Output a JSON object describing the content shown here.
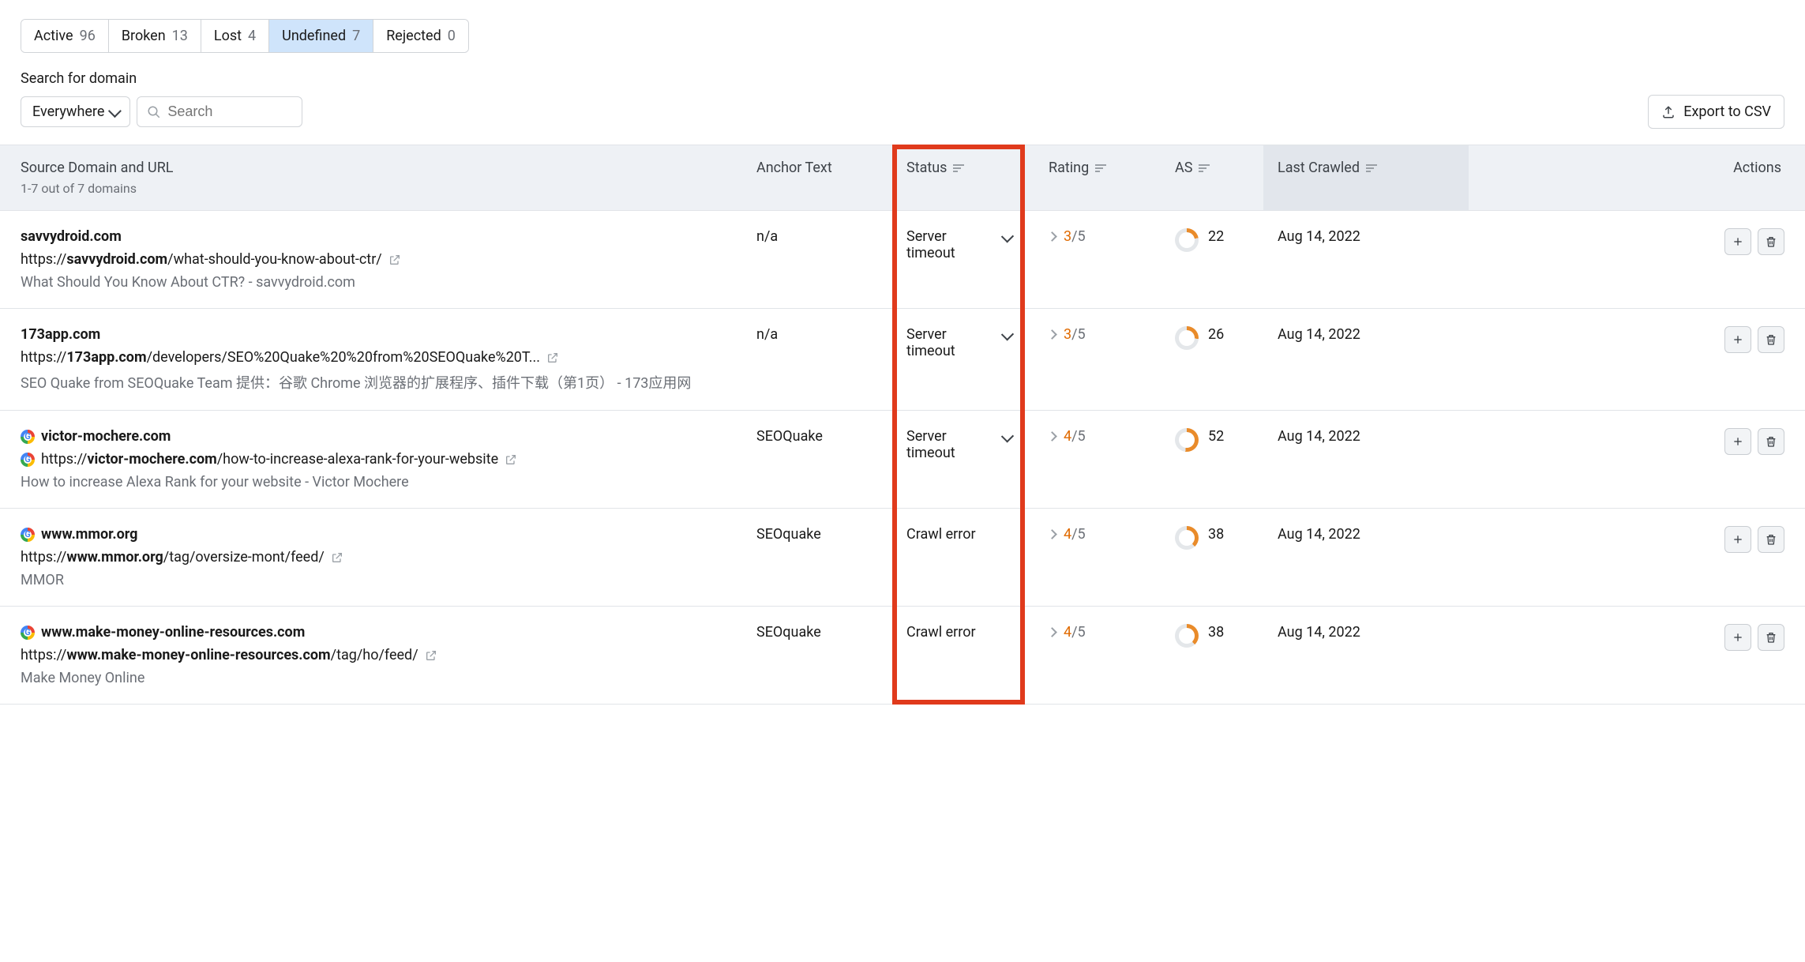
{
  "tabs": [
    {
      "label": "Active",
      "count": "96",
      "active": false
    },
    {
      "label": "Broken",
      "count": "13",
      "active": false
    },
    {
      "label": "Lost",
      "count": "4",
      "active": false
    },
    {
      "label": "Undefined",
      "count": "7",
      "active": true
    },
    {
      "label": "Rejected",
      "count": "0",
      "active": false
    }
  ],
  "search": {
    "label": "Search for domain",
    "scope": "Everywhere",
    "placeholder": "Search"
  },
  "export_label": "Export to CSV",
  "columns": {
    "source": "Source Domain and URL",
    "source_sub": "1-7 out of 7 domains",
    "anchor": "Anchor Text",
    "status": "Status",
    "rating": "Rating",
    "as": "AS",
    "last_crawled": "Last Crawled",
    "actions": "Actions"
  },
  "rows": [
    {
      "favicon": null,
      "domain": "savvydroid.com",
      "url_pre": "https://",
      "url_bold": "savvydroid.com",
      "url_path": "/what-should-you-know-about-ctr/",
      "title": "What Should You Know About CTR? - savvydroid.com",
      "anchor": "n/a",
      "status": "Server timeout",
      "status_dropdown": true,
      "rating_cur": "3",
      "rating_tot": "/5",
      "as": "22",
      "as_pct": 22,
      "crawled": "Aug 14, 2022"
    },
    {
      "favicon": null,
      "domain": "173app.com",
      "url_pre": "https://",
      "url_bold": "173app.com",
      "url_path": "/developers/SEO%20Quake%20%20from%20SEOQuake%20T...",
      "title": "SEO Quake from SEOQuake Team 提供：谷歌 Chrome 浏览器的扩展程序、插件下载（第1页） - 173应用网",
      "anchor": "n/a",
      "status": "Server timeout",
      "status_dropdown": true,
      "rating_cur": "3",
      "rating_tot": "/5",
      "as": "26",
      "as_pct": 26,
      "crawled": "Aug 14, 2022"
    },
    {
      "favicon": "google",
      "domain": "victor-mochere.com",
      "url_pre": "https://",
      "url_bold": "victor-mochere.com",
      "url_path": "/how-to-increase-alexa-rank-for-your-website",
      "url_favicon": "google",
      "title": "How to increase Alexa Rank for your website - Victor Mochere",
      "anchor": "SEOQuake",
      "status": "Server timeout",
      "status_dropdown": true,
      "rating_cur": "4",
      "rating_tot": "/5",
      "as": "52",
      "as_pct": 52,
      "crawled": "Aug 14, 2022"
    },
    {
      "favicon": "google",
      "domain": "www.mmor.org",
      "url_pre": "https://",
      "url_bold": "www.mmor.org",
      "url_path": "/tag/oversize-mont/feed/",
      "title": "MMOR",
      "anchor": "SEOquake",
      "status": "Crawl error",
      "status_dropdown": false,
      "rating_cur": "4",
      "rating_tot": "/5",
      "as": "38",
      "as_pct": 38,
      "crawled": "Aug 14, 2022"
    },
    {
      "favicon": "google",
      "domain": "www.make-money-online-resources.com",
      "url_pre": "https://",
      "url_bold": "www.make-money-online-resources.com",
      "url_path": "/tag/ho/feed/",
      "title": "Make Money Online",
      "anchor": "SEOquake",
      "status": "Crawl error",
      "status_dropdown": false,
      "rating_cur": "4",
      "rating_tot": "/5",
      "as": "38",
      "as_pct": 38,
      "crawled": "Aug 14, 2022"
    }
  ]
}
